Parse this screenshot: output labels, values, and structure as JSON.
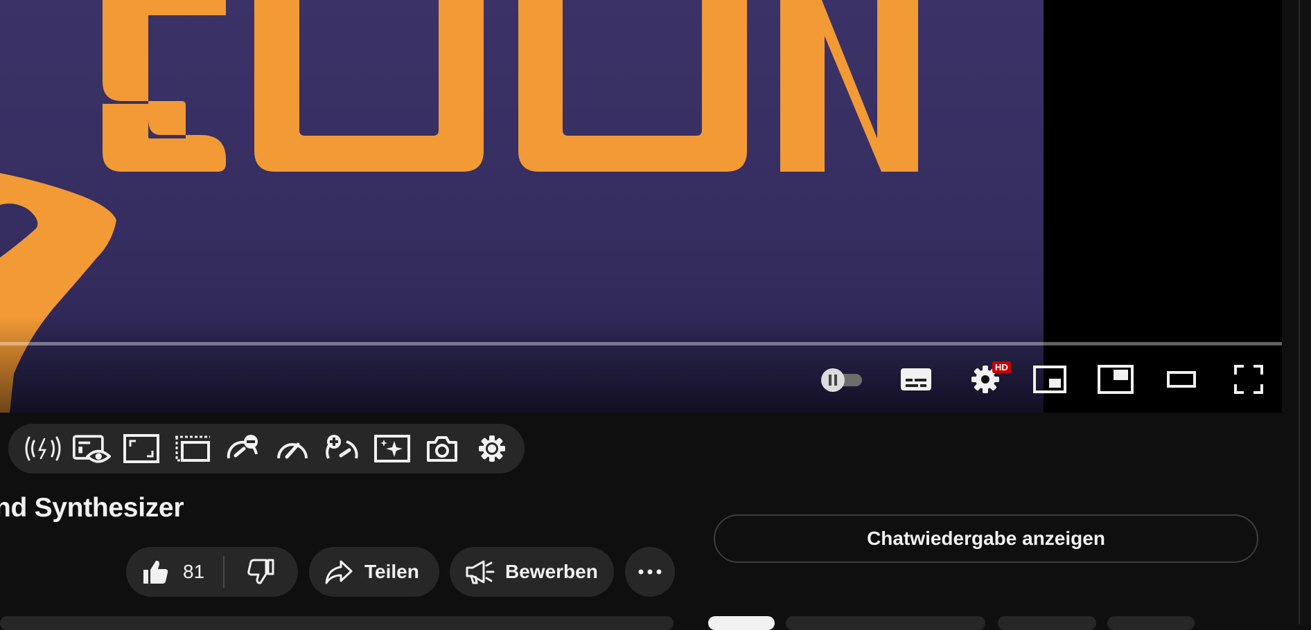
{
  "video": {
    "overlay_text": "SOON",
    "progress_percent": 0,
    "hd_badge": "HD"
  },
  "player_controls": [
    {
      "name": "autoplay-toggle",
      "icon": "pause-icon"
    },
    {
      "name": "subtitles-button",
      "icon": "subtitles-icon"
    },
    {
      "name": "settings-button",
      "icon": "gear-icon"
    },
    {
      "name": "miniplayer-button",
      "icon": "miniplayer-icon"
    },
    {
      "name": "pip-button",
      "icon": "picture-in-picture-icon"
    },
    {
      "name": "theater-mode-button",
      "icon": "theater-icon"
    },
    {
      "name": "fullscreen-button",
      "icon": "fullscreen-icon"
    }
  ],
  "extension_toolbar": [
    {
      "name": "audio-boost-button",
      "icon": "audio-signal-icon"
    },
    {
      "name": "watch-later-view-button",
      "icon": "eye-card-icon"
    },
    {
      "name": "resize-button",
      "icon": "resize-frame-icon"
    },
    {
      "name": "cinema-button",
      "icon": "cinema-icon"
    },
    {
      "name": "speed-decrease-button",
      "icon": "speed-minus-icon"
    },
    {
      "name": "speed-button",
      "icon": "speedometer-icon"
    },
    {
      "name": "speed-increase-button",
      "icon": "speed-plus-icon"
    },
    {
      "name": "enhance-button",
      "icon": "sparkle-frame-icon"
    },
    {
      "name": "screenshot-button",
      "icon": "camera-icon"
    },
    {
      "name": "toolbar-settings-button",
      "icon": "gear-icon"
    }
  ],
  "title": "nd Synthesizer",
  "actions": {
    "like_count": "81",
    "share_label": "Teilen",
    "promote_label": "Bewerben"
  },
  "chat": {
    "replay_label": "Chatwiedergabe anzeigen"
  },
  "colors": {
    "accent_orange": "#f39a32",
    "video_purple": "#3a3165",
    "background": "#0f0f0f",
    "pill": "#272727",
    "hd_badge": "#cc0000"
  }
}
